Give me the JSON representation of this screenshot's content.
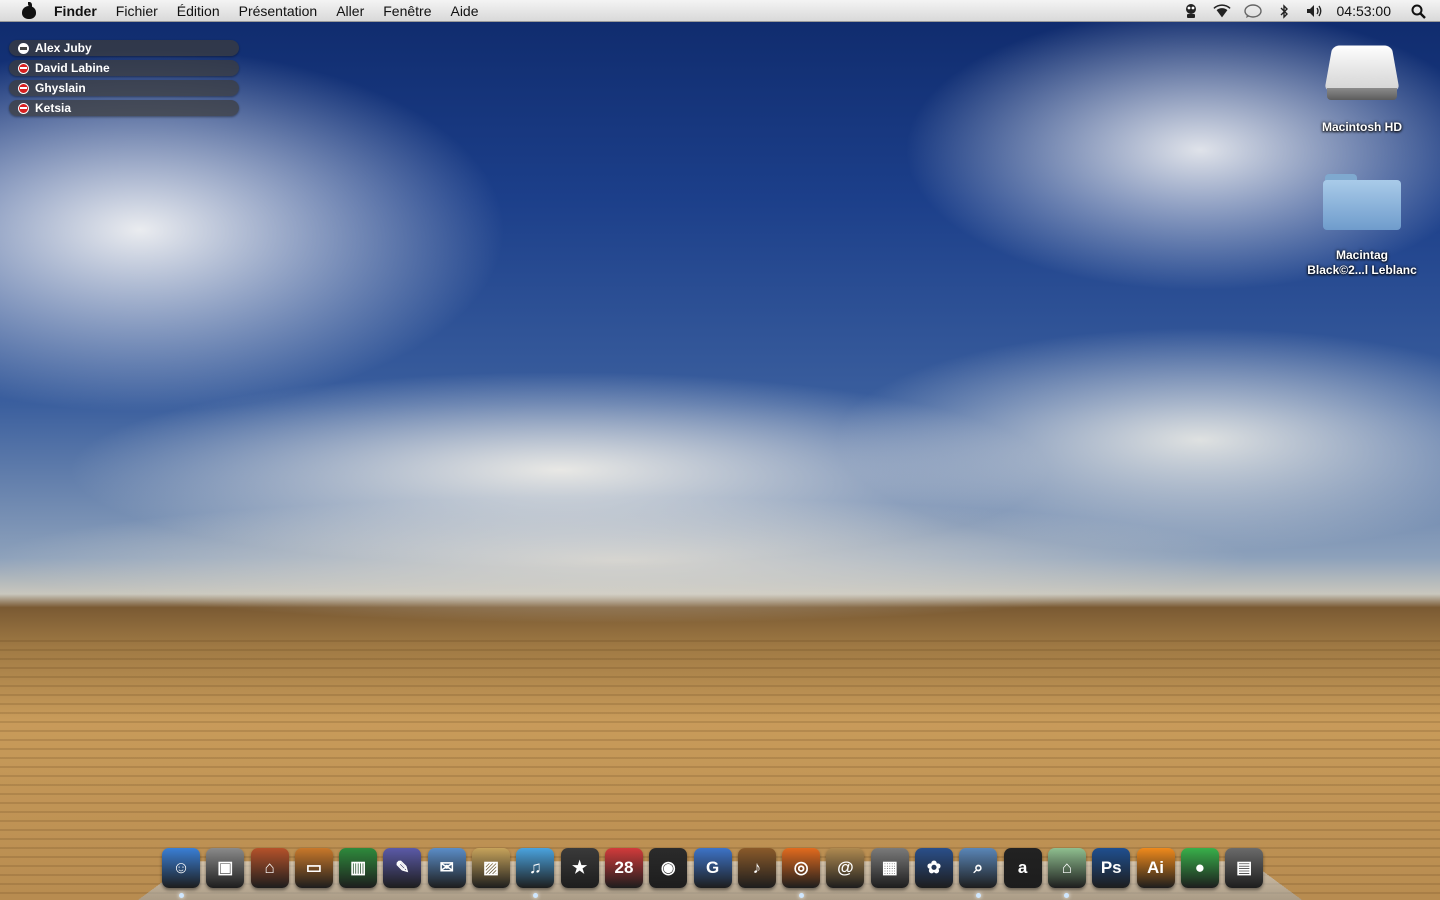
{
  "menubar": {
    "app_name": "Finder",
    "items": [
      "Fichier",
      "Édition",
      "Présentation",
      "Aller",
      "Fenêtre",
      "Aide"
    ],
    "status_icons": [
      "messenger-icon",
      "wifi-icon",
      "speech-bubble-icon",
      "bluetooth-icon",
      "volume-icon"
    ],
    "clock": "04:53:00"
  },
  "buddies": [
    {
      "name": "Alex Juby",
      "status": "away"
    },
    {
      "name": "David Labine",
      "status": "busy"
    },
    {
      "name": "Ghyslain",
      "status": "busy"
    },
    {
      "name": "Ketsia",
      "status": "busy"
    }
  ],
  "desktop_icons": [
    {
      "label": "Macintosh HD",
      "icon": "hard-drive-icon"
    },
    {
      "label_line1": "Macintag",
      "label_line2": "Black©2...l Leblanc",
      "icon": "folder-icon"
    }
  ],
  "dock": {
    "apps": [
      {
        "icon": "finder-icon",
        "glyph": "☺",
        "color": "#3a7fd6",
        "running": true
      },
      {
        "icon": "screenshot-icon",
        "glyph": "▣",
        "color": "#8a8a8a",
        "running": false
      },
      {
        "icon": "home-icon",
        "glyph": "⌂",
        "color": "#b5522a",
        "running": false
      },
      {
        "icon": "keynote-icon",
        "glyph": "▭",
        "color": "#c9782a",
        "running": false
      },
      {
        "icon": "numbers-icon",
        "glyph": "▥",
        "color": "#2e8a3c",
        "running": false
      },
      {
        "icon": "script-editor-icon",
        "glyph": "✎",
        "color": "#5b5aa8",
        "running": false
      },
      {
        "icon": "mail-icon",
        "glyph": "✉",
        "color": "#5b8dc8",
        "running": false
      },
      {
        "icon": "iphoto-icon",
        "glyph": "▨",
        "color": "#c7a35b",
        "running": false
      },
      {
        "icon": "itunes-icon",
        "glyph": "♫",
        "color": "#4aa3df",
        "running": true
      },
      {
        "icon": "imovie-icon",
        "glyph": "★",
        "color": "#3a3a3a",
        "running": false
      },
      {
        "icon": "ical-icon",
        "glyph": "28",
        "color": "#d23b3b",
        "running": false
      },
      {
        "icon": "dvd-player-icon",
        "glyph": "◉",
        "color": "#2b2b2b",
        "running": false
      },
      {
        "icon": "google-icon",
        "glyph": "G",
        "color": "#3d73c8",
        "running": false
      },
      {
        "icon": "garageband-icon",
        "glyph": "♪",
        "color": "#8a5a2a",
        "running": false
      },
      {
        "icon": "firefox-icon",
        "glyph": "◎",
        "color": "#e26b1e",
        "running": true
      },
      {
        "icon": "address-book-icon",
        "glyph": "@",
        "color": "#b08a50",
        "running": false
      },
      {
        "icon": "calculator-icon",
        "glyph": "▦",
        "color": "#7a7a7a",
        "running": false
      },
      {
        "icon": "frog-icon",
        "glyph": "✿",
        "color": "#2a4f8a",
        "running": false
      },
      {
        "icon": "preview-icon",
        "glyph": "⌕",
        "color": "#5a86b8",
        "running": true
      },
      {
        "icon": "amazon-icon",
        "glyph": "a",
        "color": "#222222",
        "running": false
      },
      {
        "icon": "cydia-icon",
        "glyph": "⌂",
        "color": "#8fbf8f",
        "running": true
      },
      {
        "icon": "photoshop-icon",
        "glyph": "Ps",
        "color": "#1f4f8f",
        "running": false
      },
      {
        "icon": "illustrator-icon",
        "glyph": "Ai",
        "color": "#f08a1c",
        "running": false
      },
      {
        "icon": "green-orb-icon",
        "glyph": "●",
        "color": "#38b04a",
        "running": false
      },
      {
        "icon": "trash-icon",
        "glyph": "▤",
        "color": "#6a6a6a",
        "running": false
      }
    ]
  }
}
